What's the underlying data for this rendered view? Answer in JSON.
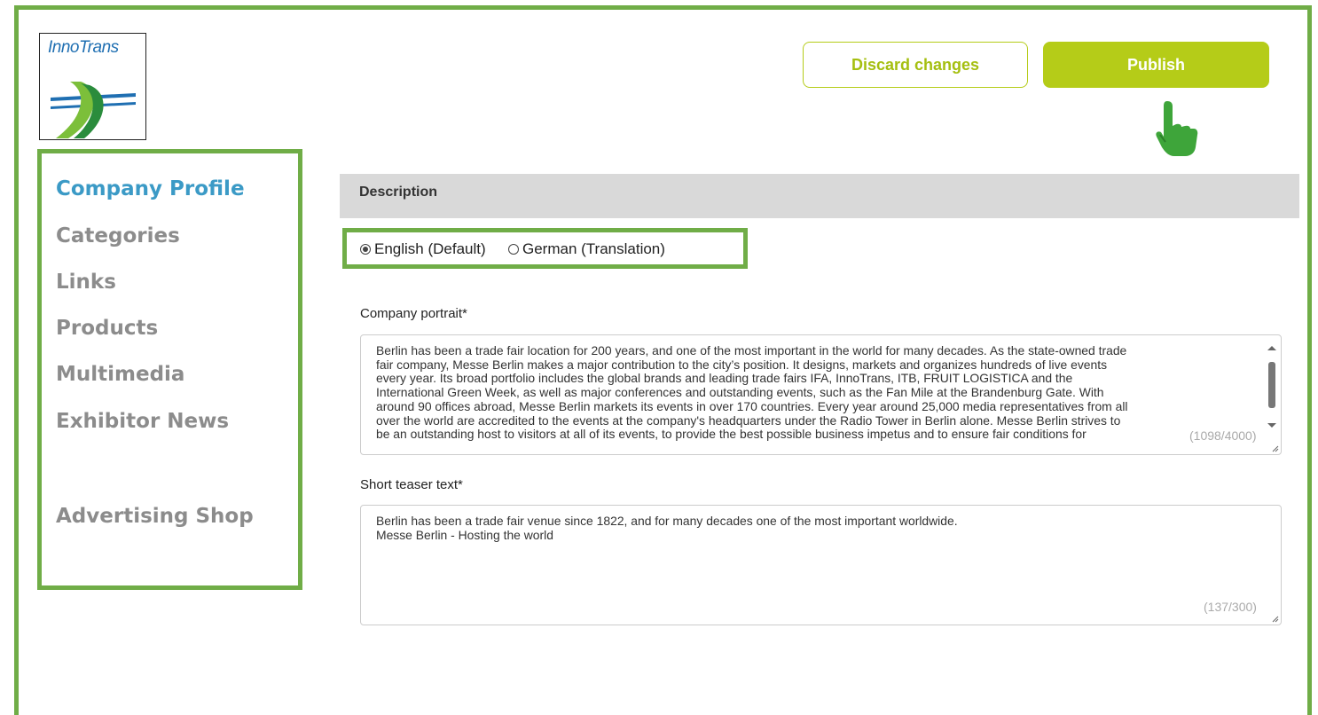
{
  "brand": {
    "logo_text": "InnoTrans"
  },
  "toolbar": {
    "discard_label": "Discard changes",
    "publish_label": "Publish"
  },
  "sidebar": {
    "items": [
      {
        "label": "Company Profile",
        "active": true
      },
      {
        "label": "Categories"
      },
      {
        "label": "Links"
      },
      {
        "label": "Products"
      },
      {
        "label": "Multimedia"
      },
      {
        "label": "Exhibitor News"
      },
      {
        "label": "Advertising Shop"
      }
    ]
  },
  "section": {
    "title": "Description"
  },
  "language": {
    "options": [
      {
        "label": "English (Default)",
        "selected": true
      },
      {
        "label": "German (Translation)",
        "selected": false
      }
    ]
  },
  "portrait": {
    "label": "Company portrait*",
    "text": "Berlin has been a trade fair location for 200 years, and one of the most important in the world for many decades. As the state-owned trade\nfair company, Messe Berlin makes a major contribution to the city’s position. It designs, markets and organizes hundreds of live events\nevery year. Its broad portfolio includes the global brands and leading trade fairs IFA, InnoTrans, ITB, FRUIT LOGISTICA and the\nInternational Green Week, as well as major conferences and outstanding events, such as the Fan Mile at the Brandenburg Gate. With\naround 90 offices abroad, Messe Berlin markets its events in over 170 countries. Every year around 25,000 media representatives from all\nover the world are accredited to the events at the company's headquarters under the Radio Tower in Berlin alone. Messe Berlin strives to\nbe an outstanding host to visitors at all of its events, to provide the best possible business impetus and to ensure fair conditions for",
    "counter": "(1098/4000)"
  },
  "teaser": {
    "label": "Short teaser text*",
    "text": "Berlin has been a trade fair venue since 1822, and for many decades one of the most important worldwide.\nMesse Berlin - Hosting the world",
    "counter": "(137/300)"
  },
  "colors": {
    "highlight_green": "#70ad47",
    "accent_lime": "#b5cc18",
    "active_nav": "#3b9ac6",
    "inactive_nav": "#8c8c8c"
  },
  "icons": [
    "pointing-hand-icon",
    "radio-checked-icon",
    "radio-unchecked-icon",
    "scroll-up-icon",
    "scroll-down-icon",
    "resize-handle-icon"
  ]
}
